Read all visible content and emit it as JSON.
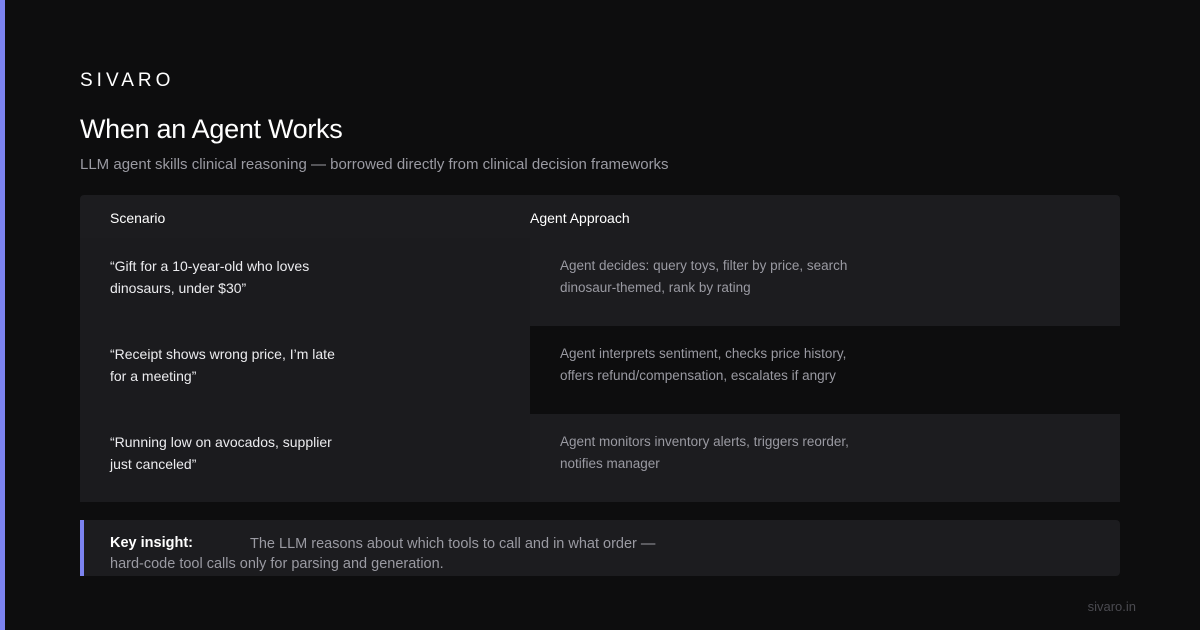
{
  "brand": "SIVARO",
  "title": "When an Agent Works",
  "subtitle": "LLM agent skills clinical reasoning — borrowed directly from clinical decision frameworks",
  "table": {
    "headers": {
      "scenario": "Scenario",
      "approach": "Agent Approach"
    },
    "rows": [
      {
        "scenario": "“Gift for a 10-year-old who loves dinosaurs, under $30”",
        "approach": "Agent decides: query toys, filter by price, search dinosaur-themed, rank by rating"
      },
      {
        "scenario": "“Receipt shows wrong price, I’m late for a meeting”",
        "approach": "Agent interprets sentiment, checks price history, offers refund/compensation, escalates if angry"
      },
      {
        "scenario": "“Running low on avocados, supplier just canceled”",
        "approach": "Agent monitors inventory alerts, triggers reorder, notifies manager"
      }
    ]
  },
  "insight": {
    "label": "Key insight:",
    "text": "The LLM reasons about which tools to call and in what order — hard-code tool calls only for parsing and generation."
  },
  "footer": "sivaro.in",
  "colors": {
    "accent": "#7c83f0",
    "background": "#0d0d0e",
    "panel": "#1c1c1f"
  }
}
